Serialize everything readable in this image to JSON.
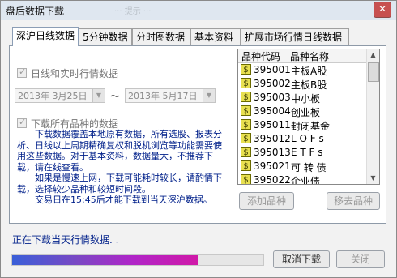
{
  "window": {
    "title": "盘后数据下载",
    "close_glyph": "✕",
    "ghost_text": "··· 提示 ···"
  },
  "tabs": [
    {
      "label": "深沪日线数据",
      "active": true
    },
    {
      "label": "5分钟数据",
      "active": false
    },
    {
      "label": "分时图数据",
      "active": false
    },
    {
      "label": "基本资料",
      "active": false
    },
    {
      "label": "扩展市场行情日线数据",
      "active": false
    }
  ],
  "options": {
    "daily_realtime_label": "日线和实时行情数据",
    "download_all_label": "下载所有品种的数据"
  },
  "dates": {
    "start": "2013年 3月25日",
    "end": "2013年 5月17日",
    "sep": "～",
    "dd": "▼"
  },
  "description": [
    "下载数据覆盖本地原有数据，所有选股、报表分析、日线以上周期精确复权和脱机浏览等功能需要使用这些数据。对于基本资料，数据量大，不推荐下载，请在线查看。",
    "如果是慢速上网，下载可能耗时较长，请酌情下载，选择较少品种和较短时间段。",
    "交易日在15:45后才能下载到当天深沪数据。"
  ],
  "list": {
    "headers": [
      "品种代码",
      "品种名称"
    ],
    "icon_glyph": "$",
    "rows": [
      {
        "code": "395001",
        "name": "主板A股"
      },
      {
        "code": "395002",
        "name": "主板B股"
      },
      {
        "code": "395003",
        "name": "中小板"
      },
      {
        "code": "395004",
        "name": "创业板"
      },
      {
        "code": "395011",
        "name": "封闭基金"
      },
      {
        "code": "395012",
        "name": "L O F s"
      },
      {
        "code": "395013",
        "name": "E T F s"
      },
      {
        "code": "395021",
        "name": "可 转 债"
      },
      {
        "code": "395022",
        "name": "企业债"
      }
    ]
  },
  "buttons": {
    "add": "添加品种",
    "remove": "移去品种",
    "cancel": "取消下载",
    "close": "关闭"
  },
  "status": {
    "text": "正在下载当天行情数据. .",
    "progress": 0.74
  },
  "colors": {
    "desc_text": "#00208a",
    "progress_start": "#3a5fd8",
    "progress_end": "#d019a8"
  }
}
